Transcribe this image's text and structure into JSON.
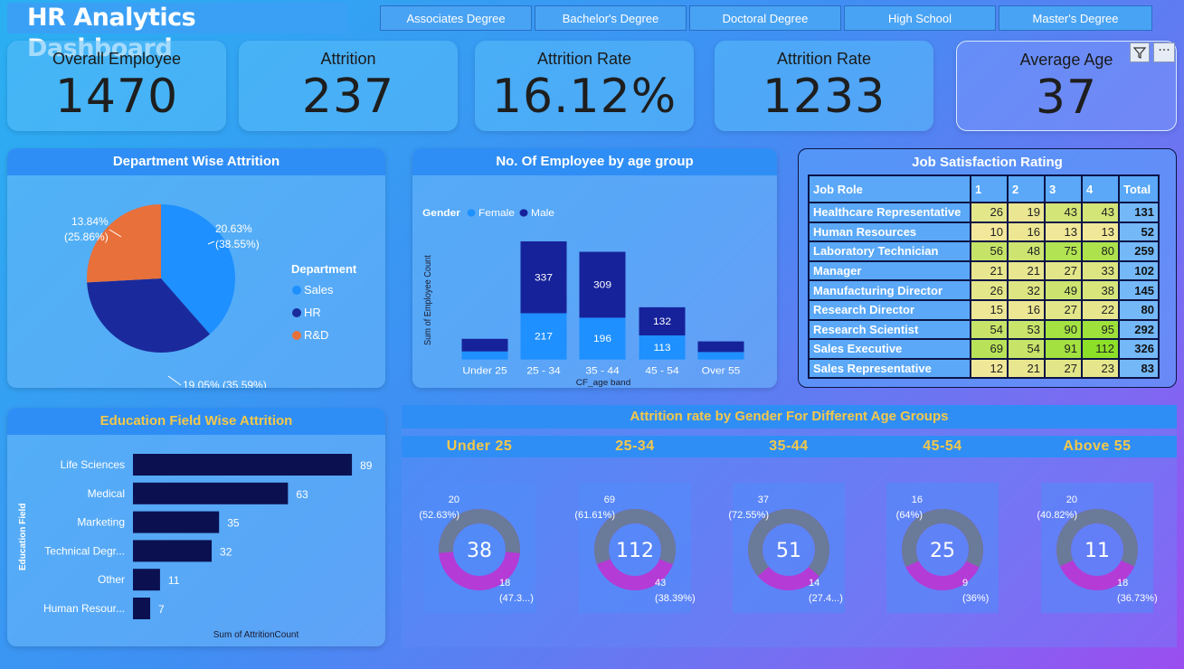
{
  "title": "HR Analytics Dashboard",
  "slicers": [
    "Associates Degree",
    "Bachelor's Degree",
    "Doctoral Degree",
    "High School",
    "Master's Degree"
  ],
  "kpis": [
    {
      "label": "Overall Employee",
      "value": "1470"
    },
    {
      "label": "Attrition",
      "value": "237"
    },
    {
      "label": "Attrition Rate",
      "value": "16.12%"
    },
    {
      "label": "Attrition Rate",
      "value": "1233"
    },
    {
      "label": "Average Age",
      "value": "37"
    }
  ],
  "colors": {
    "sales": "#1e90ff",
    "hr": "#1a2a9c",
    "rnd": "#e8703a",
    "female": "#1e90ff",
    "male": "#16229a",
    "bar": "#0b1150",
    "donut_grey": "#6a7a99",
    "donut_pink": "#b43bd6",
    "heat_low": "#f3e79b",
    "heat_high": "#8de028"
  },
  "chart_data": [
    {
      "type": "pie",
      "title": "Department Wise Attrition",
      "legend_title": "Department",
      "legend_placement": "right",
      "labels": [
        "Sales",
        "HR",
        "R&D"
      ],
      "values": [
        38.55,
        35.59,
        25.86
      ],
      "data_labels": [
        "20.63% (38.55%)",
        "19.05% (35.59%)",
        "13.84% (25.86%)"
      ]
    },
    {
      "type": "bar",
      "stacked": true,
      "title": "No. Of Employee by age group",
      "legend_title": "Gender",
      "legend_placement": "top-left",
      "xlabel": "CF_age band",
      "ylabel": "Sum of Employee Count",
      "categories": [
        "Under 25",
        "25 - 34",
        "35 - 44",
        "45 - 54",
        "Over 55"
      ],
      "series": [
        {
          "name": "Female",
          "values": [
            38,
            217,
            196,
            113,
            35
          ],
          "labels": [
            "",
            "217",
            "196",
            "113",
            ""
          ]
        },
        {
          "name": "Male",
          "values": [
            59,
            337,
            309,
            132,
            50
          ],
          "labels": [
            "",
            "337",
            "309",
            "132",
            ""
          ]
        }
      ],
      "ylim": [
        0,
        600
      ]
    },
    {
      "type": "table",
      "title": "Job Satisfaction Rating",
      "columns": [
        "Job Role",
        "1",
        "2",
        "3",
        "4",
        "Total"
      ],
      "rows": [
        [
          "Healthcare Representative",
          26,
          19,
          43,
          43,
          131
        ],
        [
          "Human Resources",
          10,
          16,
          13,
          13,
          52
        ],
        [
          "Laboratory Technician",
          56,
          48,
          75,
          80,
          259
        ],
        [
          "Manager",
          21,
          21,
          27,
          33,
          102
        ],
        [
          "Manufacturing Director",
          26,
          32,
          49,
          38,
          145
        ],
        [
          "Research Director",
          15,
          16,
          27,
          22,
          80
        ],
        [
          "Research Scientist",
          54,
          53,
          90,
          95,
          292
        ],
        [
          "Sales Executive",
          69,
          54,
          91,
          112,
          326
        ],
        [
          "Sales Representative",
          12,
          21,
          27,
          23,
          83
        ]
      ]
    },
    {
      "type": "bar",
      "orientation": "horizontal",
      "title": "Education Field Wise Attrition",
      "xlabel": "Sum of AttritionCount",
      "ylabel": "Education Field",
      "categories": [
        "Life Sciences",
        "Medical",
        "Marketing",
        "Technical Degr...",
        "Other",
        "Human Resour..."
      ],
      "values": [
        89,
        63,
        35,
        32,
        11,
        7
      ],
      "xlim": [
        0,
        100
      ]
    },
    {
      "type": "pie",
      "title": "Attrition rate by Gender For Different Age Groups",
      "donuts": [
        {
          "group": "Under 25",
          "total": "38",
          "top_count": "20",
          "top_pct": "(52.63%)",
          "bottom_count": "18",
          "bottom_pct": "(47.3...)",
          "top_share": 52.63
        },
        {
          "group": "25-34",
          "total": "112",
          "top_count": "69",
          "top_pct": "(61.61%)",
          "bottom_count": "43",
          "bottom_pct": "(38.39%)",
          "top_share": 61.61
        },
        {
          "group": "35-44",
          "total": "51",
          "top_count": "37",
          "top_pct": "(72.55%)",
          "bottom_count": "14",
          "bottom_pct": "(27.4...)",
          "top_share": 72.55
        },
        {
          "group": "45-54",
          "total": "25",
          "top_count": "16",
          "top_pct": "(64%)",
          "bottom_count": "9",
          "bottom_pct": "(36%)",
          "top_share": 64
        },
        {
          "group": "Above 55",
          "total": "11",
          "top_count": "20",
          "top_pct": "(40.82%)",
          "bottom_count": "18",
          "bottom_pct": "(36.73%)",
          "top_share": 63.27
        }
      ]
    }
  ]
}
